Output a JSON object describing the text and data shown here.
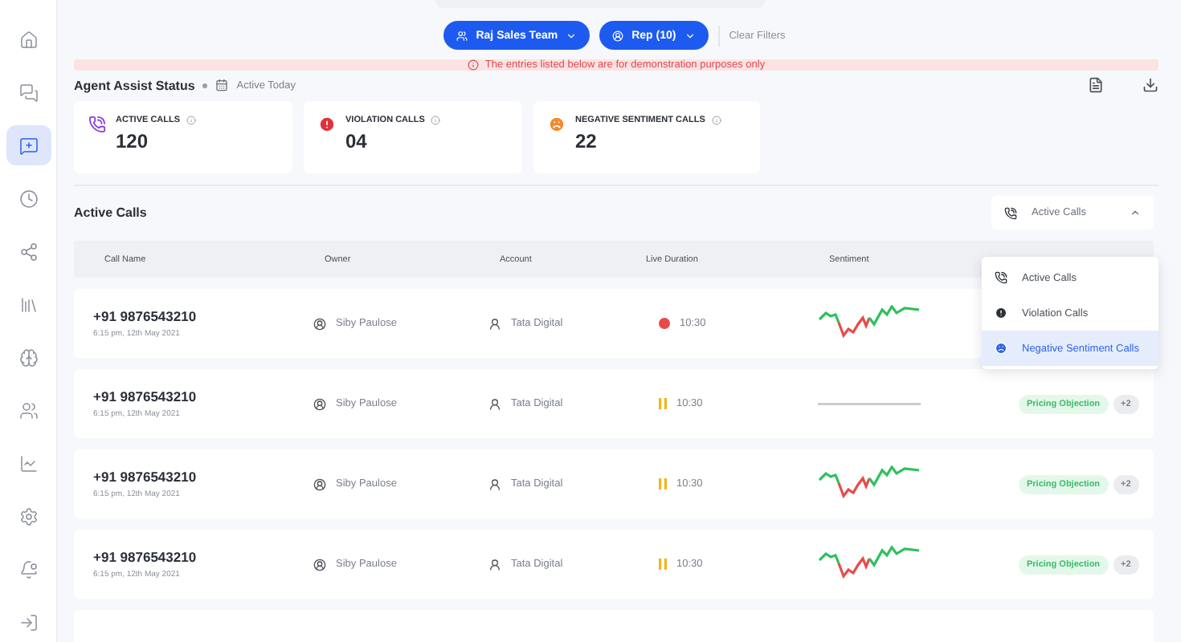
{
  "sidebar": {
    "items": [
      {
        "selected": false
      },
      {
        "selected": false
      },
      {
        "selected": true
      },
      {
        "selected": false
      },
      {
        "selected": false
      },
      {
        "selected": false
      },
      {
        "selected": false
      },
      {
        "selected": false
      },
      {
        "selected": false
      },
      {
        "selected": false
      },
      {
        "selected": false
      },
      {
        "selected": false
      }
    ]
  },
  "filters": {
    "team": "Raj Sales Team",
    "rep": "Rep (10)",
    "clear": "Clear Filters"
  },
  "notice": "The entries listed below are for demonstration purposes only",
  "status": {
    "title": "Agent Assist Status",
    "period": "Active Today"
  },
  "cards": [
    {
      "kind": "active",
      "label": "ACTIVE CALLS",
      "value": "120"
    },
    {
      "kind": "violation",
      "label": "VIOLATION CALLS",
      "value": "04"
    },
    {
      "kind": "negative",
      "label": "NEGATIVE SENTIMENT CALLS",
      "value": "22"
    }
  ],
  "section": {
    "title": "Active Calls",
    "select": "Active Calls",
    "expanded": true
  },
  "menu": [
    {
      "kind": "active",
      "label": "Active Calls",
      "selected": false
    },
    {
      "kind": "violation",
      "label": "Violation Calls",
      "selected": false
    },
    {
      "kind": "negative",
      "label": "Negative Sentiment Calls",
      "selected": true
    }
  ],
  "table": {
    "columns": [
      "Call Name",
      "Owner",
      "Account",
      "Live Duration",
      "Sentiment"
    ],
    "rows": [
      {
        "kind": "wave",
        "phone": "+91 9876543210",
        "time": "6:15 pm, 12th May 2021",
        "owner": "Siby Paulose",
        "account": "Tata Digital",
        "live": true,
        "duration": "10:30",
        "tags": []
      },
      {
        "kind": "flat",
        "phone": "+91 9876543210",
        "time": "6:15 pm, 12th May 2021",
        "owner": "Siby Paulose",
        "account": "Tata Digital",
        "live": false,
        "duration": "10:30",
        "tags": [
          "Pricing Objection",
          "+2"
        ]
      },
      {
        "kind": "wave",
        "phone": "+91 9876543210",
        "time": "6:15 pm, 12th May 2021",
        "owner": "Siby Paulose",
        "account": "Tata Digital",
        "live": false,
        "duration": "10:30",
        "tags": [
          "Pricing Objection",
          "+2"
        ]
      },
      {
        "kind": "wave",
        "phone": "+91 9876543210",
        "time": "6:15 pm, 12th May 2021",
        "owner": "Siby Paulose",
        "account": "Tata Digital",
        "live": false,
        "duration": "10:30",
        "tags": [
          "Pricing Objection",
          "+2"
        ]
      }
    ]
  }
}
